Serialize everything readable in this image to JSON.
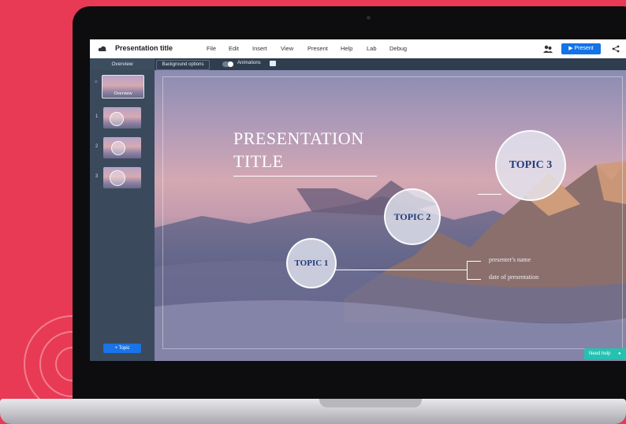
{
  "app": {
    "title": "Presentation title",
    "menu": [
      "File",
      "Edit",
      "Insert",
      "View",
      "Present",
      "Help",
      "Lab",
      "Debug"
    ],
    "present_button": "Present"
  },
  "toolbar": {
    "overview_tab": "Overview",
    "background_options": "Background options",
    "animations_label": "Animations"
  },
  "sidebar": {
    "overview_label": "Overview",
    "slides": [
      "1",
      "2",
      "3"
    ],
    "add_topic_button": "+ Topic"
  },
  "slide": {
    "title_line1": "PRESENTATION",
    "title_line2": "TITLE",
    "topic1": "TOPIC 1",
    "topic2": "TOPIC 2",
    "topic3": "TOPIC 3",
    "presenter": "presenter's name",
    "date": "date of presentation"
  },
  "help": {
    "label": "Need help"
  },
  "colors": {
    "background": "#e83a55",
    "accent": "#1473e6",
    "help": "#25c2b0",
    "topic_text": "#233c7a"
  },
  "icons": [
    "cloud-icon",
    "share-people-icon",
    "play-icon",
    "share-icon",
    "home-icon",
    "comment-icon",
    "help-icon"
  ]
}
